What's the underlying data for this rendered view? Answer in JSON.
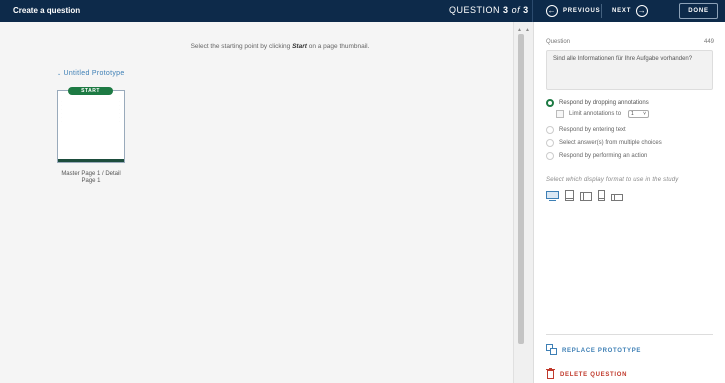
{
  "header": {
    "title": "Create a question",
    "question_prefix": "QUESTION",
    "question_current": "3",
    "question_of": "of",
    "question_total": "3",
    "prev_label": "PREVIOUS",
    "next_label": "NEXT",
    "done_label": "DONE",
    "bg_color": "#0d2a4a"
  },
  "canvas": {
    "instruction_before": "Select the starting point by clicking",
    "instruction_emph": "Start",
    "instruction_after": "on a page thumbnail.",
    "prototype_title": "Untitled Prototype",
    "start_badge": "START",
    "thumbnail_label": "Master Page 1 / Detail Page 1"
  },
  "panel": {
    "question_label": "Question",
    "char_count": "449",
    "question_text": "Sind alle Informationen für Ihre Aufgabe vorhanden?",
    "options": [
      {
        "label": "Respond by dropping annotations",
        "selected": true
      },
      {
        "label": "Respond by entering text",
        "selected": false
      },
      {
        "label": "Select answer(s) from multiple choices",
        "selected": false
      },
      {
        "label": "Respond by performing an action",
        "selected": false
      }
    ],
    "limit_label": "Limit annotations to",
    "limit_value": "1",
    "format_label": "Select which display format to use in the study",
    "format_icons": [
      "desktop-icon",
      "tablet-icon",
      "tablet-landscape-icon",
      "phone-icon",
      "phone-landscape-icon"
    ],
    "replace_label": "REPLACE PROTOTYPE",
    "delete_label": "DELETE QUESTION",
    "accent_color": "#3d7fb5",
    "selected_color": "#1d7a43",
    "danger_color": "#c0392b"
  }
}
